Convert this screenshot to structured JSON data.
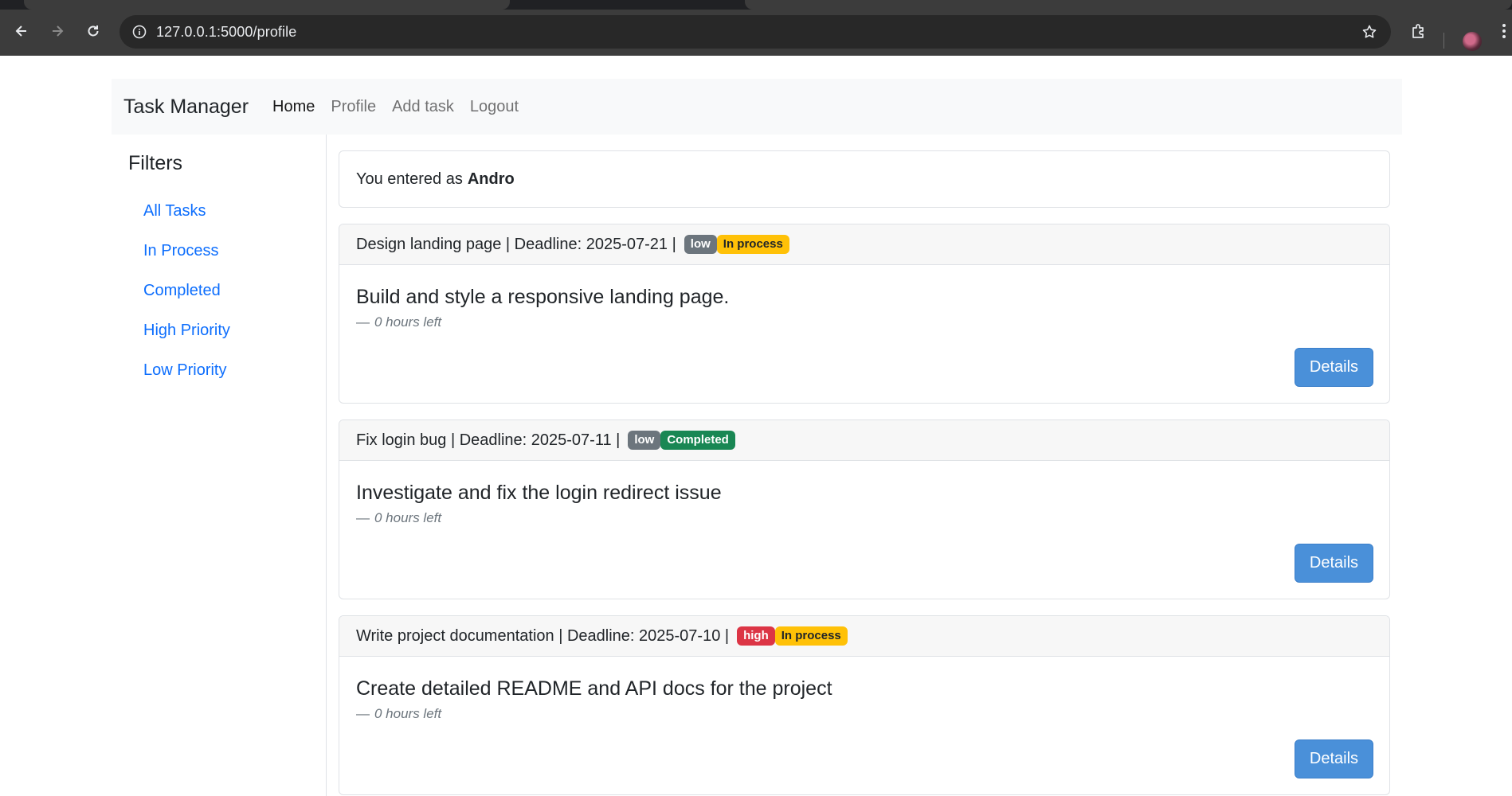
{
  "browser": {
    "url": "127.0.0.1:5000/profile"
  },
  "navbar": {
    "brand": "Task Manager",
    "links": [
      {
        "label": "Home",
        "active": true
      },
      {
        "label": "Profile",
        "active": false
      },
      {
        "label": "Add task",
        "active": false
      },
      {
        "label": "Logout",
        "active": false
      }
    ]
  },
  "sidebar": {
    "title": "Filters",
    "filters": [
      "All Tasks",
      "In Process",
      "Completed",
      "High Priority",
      "Low Priority"
    ]
  },
  "welcome": {
    "prefix": "You entered as",
    "username": "Andro"
  },
  "tasks": [
    {
      "header": "Design landing page | Deadline: 2025-07-21 |",
      "priority": "low",
      "status": "In process",
      "description": "Build and style a responsive landing page.",
      "time_left": "0 hours left",
      "button": "Details"
    },
    {
      "header": "Fix login bug | Deadline: 2025-07-11 |",
      "priority": "low",
      "status": "Completed",
      "description": "Investigate and fix the login redirect issue",
      "time_left": "0 hours left",
      "button": "Details"
    },
    {
      "header": "Write project documentation | Deadline: 2025-07-10 |",
      "priority": "high",
      "status": "In process",
      "description": "Create detailed README and API docs for the project",
      "time_left": "0 hours left",
      "button": "Details"
    }
  ],
  "icons": {
    "back": "arrow-left-icon",
    "forward": "arrow-right-icon",
    "reload": "reload-icon",
    "site_info": "site-info-icon",
    "bookmark": "star-icon",
    "extensions": "puzzle-icon",
    "menu": "kebab-menu-icon"
  },
  "colors": {
    "link": "#0d6efd",
    "badge_low": "#6c757d",
    "badge_high": "#dc3545",
    "badge_in_process": "#ffc107",
    "badge_completed": "#198754",
    "details_button": "#4a90d9"
  }
}
